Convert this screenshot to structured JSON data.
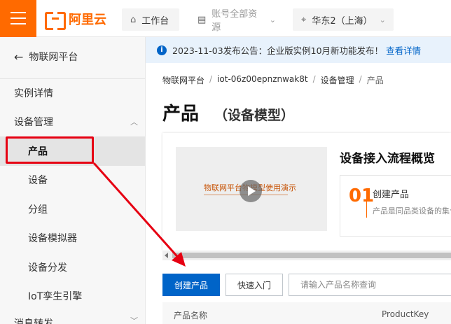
{
  "header": {
    "logo_text": "阿里云",
    "workbench": "工作台",
    "resources": "账号全部资源",
    "region": "华东2（上海）",
    "brand_color": "#ff6a00"
  },
  "sidebar": {
    "back_label": "物联网平台",
    "items": [
      {
        "label": "实例详情"
      },
      {
        "label": "设备管理"
      },
      {
        "label": "产品"
      },
      {
        "label": "设备"
      },
      {
        "label": "分组"
      },
      {
        "label": "设备模拟器"
      },
      {
        "label": "设备分发"
      },
      {
        "label": "IoT孪生引擎"
      },
      {
        "label": "消息转发"
      }
    ],
    "active": "产品"
  },
  "notice": {
    "text": "2023-11-03发布公告：企业版实例10月新功能发布！",
    "link": "查看详情"
  },
  "breadcrumb": {
    "items": [
      "物联网平台",
      "iot-06z00epnznwak8t",
      "设备管理",
      "产品"
    ]
  },
  "page": {
    "title": "产品",
    "subtitle": "（设备模型）"
  },
  "intro": {
    "video_title": "物联网平台物模型使用演示",
    "flow_title": "设备接入流程概览",
    "step_number": "01",
    "step_name": "创建产品",
    "step_desc": "产品是同品类设备的集合"
  },
  "toolbar": {
    "create_label": "创建产品",
    "quickstart_label": "快速入门",
    "search_placeholder": "请输入产品名称查询"
  },
  "table": {
    "columns": [
      "产品名称",
      "ProductKey"
    ]
  },
  "colors": {
    "primary": "#0064c8",
    "annotation": "#e60012"
  }
}
